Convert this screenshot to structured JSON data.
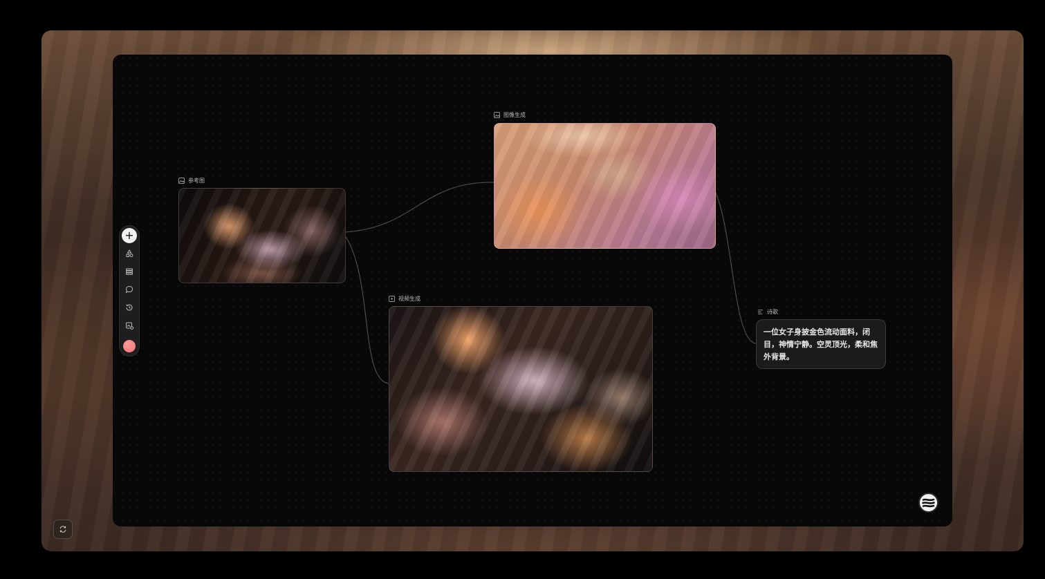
{
  "nodes": {
    "reference": {
      "label": "参考图",
      "icon": "image-icon"
    },
    "image_gen": {
      "label": "图像生成",
      "icon": "image-icon"
    },
    "video_gen": {
      "label": "视频生成",
      "icon": "play-icon"
    },
    "poem": {
      "label": "诗歌",
      "icon": "text-lines-icon",
      "text": "一位女子身披金色流动面料，闭目，神情宁静。空灵顶光，柔和焦外背景。"
    }
  },
  "toolbar": {
    "add_label": "+",
    "items": [
      "add-icon",
      "shapes-icon",
      "layers-icon",
      "chat-icon",
      "history-icon",
      "assets-icon"
    ],
    "avatar_color": "#ee6f72"
  },
  "colors": {
    "canvas_bg": "#070707",
    "node_bg": "#1b1b1b",
    "edge": "#8a8a8a"
  }
}
